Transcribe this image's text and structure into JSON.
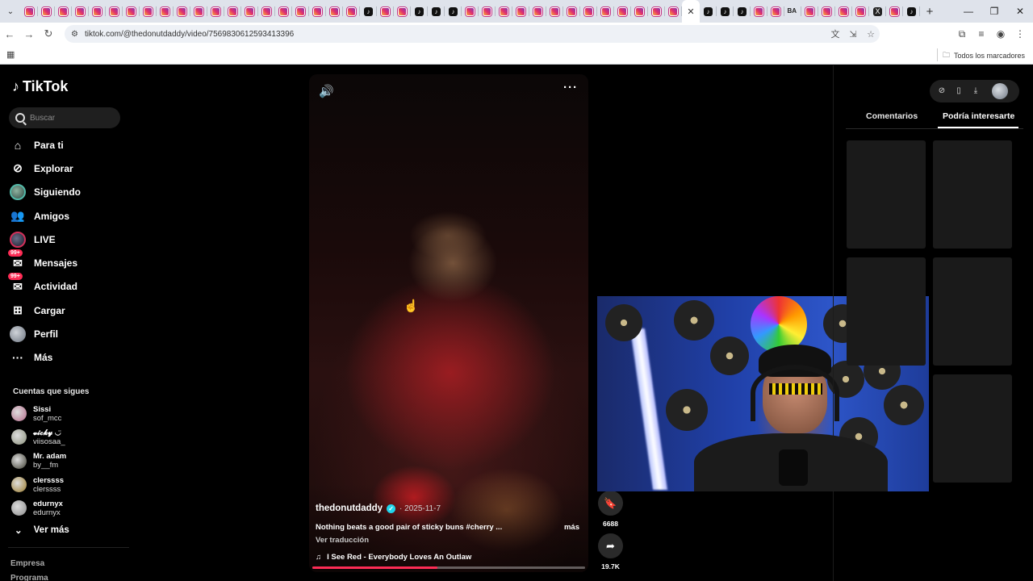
{
  "browser": {
    "tab_favicons": [
      "ig",
      "ig",
      "ig",
      "ig",
      "ig",
      "ig",
      "ig",
      "ig",
      "ig",
      "ig",
      "ig",
      "ig",
      "ig",
      "ig",
      "ig",
      "ig",
      "ig",
      "ig",
      "ig",
      "ig",
      "tt",
      "ig",
      "ig",
      "tt",
      "tt",
      "tt",
      "ig",
      "ig",
      "ig",
      "ig",
      "ig",
      "ig",
      "ig",
      "ig",
      "ig",
      "ig",
      "ig",
      "ig",
      "ig",
      "active",
      "tt",
      "tt",
      "tt",
      "ig",
      "ig",
      "ba",
      "ig",
      "ig",
      "ig",
      "ig",
      "x",
      "ig",
      "tt"
    ],
    "url": "tiktok.com/@thedonutdaddy/video/7569830612593413396",
    "bookmarks_all": "Todos los marcadores"
  },
  "sidebar": {
    "logo_text": "TikTok",
    "search_placeholder": "Buscar",
    "items": [
      {
        "label": "Para ti",
        "icon": "home-icon"
      },
      {
        "label": "Explorar",
        "icon": "compass-icon"
      },
      {
        "label": "Siguiendo",
        "icon": "following-avatar-icon"
      },
      {
        "label": "Amigos",
        "icon": "friends-icon"
      },
      {
        "label": "LIVE",
        "icon": "live-icon"
      },
      {
        "label": "Mensajes",
        "icon": "messages-icon",
        "badge": "99+"
      },
      {
        "label": "Actividad",
        "icon": "activity-icon",
        "badge": "99+"
      },
      {
        "label": "Cargar",
        "icon": "upload-icon"
      },
      {
        "label": "Perfil",
        "icon": "profile-icon"
      },
      {
        "label": "Más",
        "icon": "more-icon"
      }
    ],
    "following_title": "Cuentas que sigues",
    "following": [
      {
        "name": "Sissi",
        "handle": "sof_mcc",
        "color": "#b56a8a"
      },
      {
        "name": "𝓿𝓲𝓬𝓴𝔂 ◡̈",
        "handle": "viisosaa_",
        "color": "#8a8f7a"
      },
      {
        "name": "Mr. adam",
        "handle": "by__fm",
        "color": "#3a3a2e"
      },
      {
        "name": "clerssss",
        "handle": "clerssss",
        "color": "#9a7a2a"
      },
      {
        "name": "edurnyx",
        "handle": "edurnyx",
        "color": "#8a8a8a"
      }
    ],
    "see_more": "Ver más",
    "footer": [
      "Empresa",
      "Programa"
    ]
  },
  "video": {
    "author": "thedonutdaddy",
    "date": "· 2025-11-7",
    "caption": "Nothing beats a good pair of sticky buns #cherry ...",
    "more": "más",
    "translate": "Ver traducción",
    "music": "I See Red - Everybody Loves An Outlaw",
    "progress": 0.46
  },
  "actions": [
    {
      "name": "bookmark",
      "icon": "bookmark-icon",
      "count": "6688"
    },
    {
      "name": "share",
      "icon": "share-icon",
      "count": "19.7K"
    }
  ],
  "right_panel": {
    "tabs": [
      "Comentarios",
      "Podría interesarte"
    ],
    "active_tab": "Podría interesarte"
  },
  "colors": {
    "accent": "#fe2c55",
    "verified": "#20d5ec"
  }
}
